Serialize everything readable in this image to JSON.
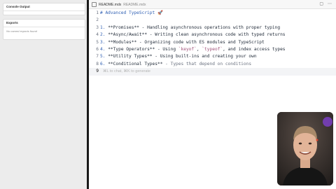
{
  "left_panel": {
    "console": {
      "title": "Console Output"
    },
    "exports": {
      "title": "Exports",
      "empty_text": "No named exports found"
    }
  },
  "tab": {
    "filename": "README.mdx",
    "path": "README.mdx",
    "close": "×"
  },
  "tab_actions": {
    "split": "▢",
    "more": "⋯"
  },
  "code_lines": [
    {
      "n": "1",
      "parts": [
        [
          "md-h",
          "# Advanced TypeScript 🚀"
        ]
      ]
    },
    {
      "n": "2",
      "parts": []
    },
    {
      "n": "3",
      "parts": [
        [
          "md-num",
          "1. "
        ],
        [
          "md-strong",
          "**Promises**"
        ],
        [
          "",
          " - Handling asynchronous operations with proper typing"
        ]
      ]
    },
    {
      "n": "4",
      "parts": [
        [
          "md-num",
          "2. "
        ],
        [
          "md-strong",
          "**Async/Await**"
        ],
        [
          "",
          " - Writing clean asynchronous code with typed returns"
        ]
      ]
    },
    {
      "n": "5",
      "parts": [
        [
          "md-num",
          "3. "
        ],
        [
          "md-strong",
          "**Modules**"
        ],
        [
          "",
          " - Organizing code with ES modules and TypeScript"
        ]
      ]
    },
    {
      "n": "6",
      "parts": [
        [
          "md-num",
          "4. "
        ],
        [
          "md-strong",
          "**Type Operators**"
        ],
        [
          "",
          " - Using "
        ],
        [
          "md-code",
          "`keyof`"
        ],
        [
          "",
          ", "
        ],
        [
          "md-code",
          "`typeof`"
        ],
        [
          "",
          ", and index access types"
        ]
      ]
    },
    {
      "n": "7",
      "parts": [
        [
          "md-num",
          "5. "
        ],
        [
          "md-strong",
          "**Utility Types**"
        ],
        [
          "",
          " - Using built-ins and creating your own"
        ]
      ]
    },
    {
      "n": "8",
      "parts": [
        [
          "md-num",
          "6. "
        ],
        [
          "md-strong",
          "**Conditional Types**"
        ],
        [
          "md-dim",
          " - Types that depend on conditions"
        ]
      ]
    },
    {
      "n": "9",
      "parts": []
    }
  ],
  "inline_hint": "⌘L to chat, ⌘K to generate",
  "colors": {
    "editor_bg": "#ffffff",
    "left_bg": "#ececec",
    "heading": "#2f5fb3",
    "code_span": "#a0527a"
  }
}
